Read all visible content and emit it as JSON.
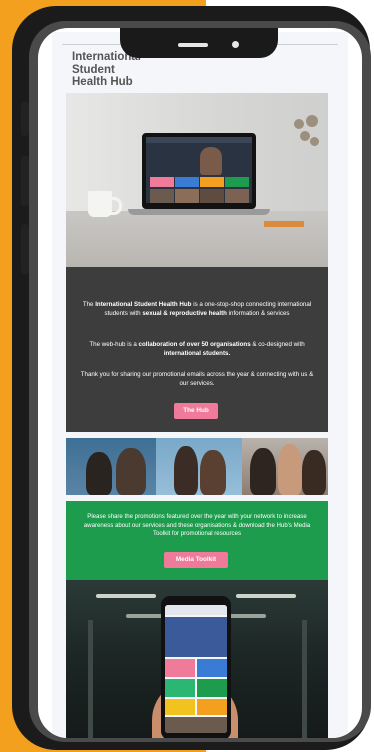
{
  "logo": {
    "line1": "International",
    "line2": "Student",
    "line3": "Health Hub"
  },
  "intro": {
    "p1_before": "The ",
    "p1_bold1": "International Student Health Hub",
    "p1_mid": " is a one-stop-shop connecting international students with ",
    "p1_bold2": "sexual & reproductive health",
    "p1_after": " information & services",
    "p2_before": "The web-hub is a ",
    "p2_bold1": "collaboration of over 50 organisations",
    "p2_mid": " & co-designed with ",
    "p2_bold2": "international students.",
    "p3": "Thank you for sharing our promotional emails across the year & connecting with us & our services.",
    "button_label": "The Hub"
  },
  "share": {
    "text": "Please share the promotions featured over the year with your network to increase awareness about our services and these organisations & download the Hub's Media Toolkit for promotional resources",
    "button_label": "Media Toolkit"
  },
  "colors": {
    "frame_orange": "#f2a01e",
    "dark_section": "#3d3d3d",
    "green_section": "#1c9c4c",
    "button_pink": "#f07a9a"
  }
}
